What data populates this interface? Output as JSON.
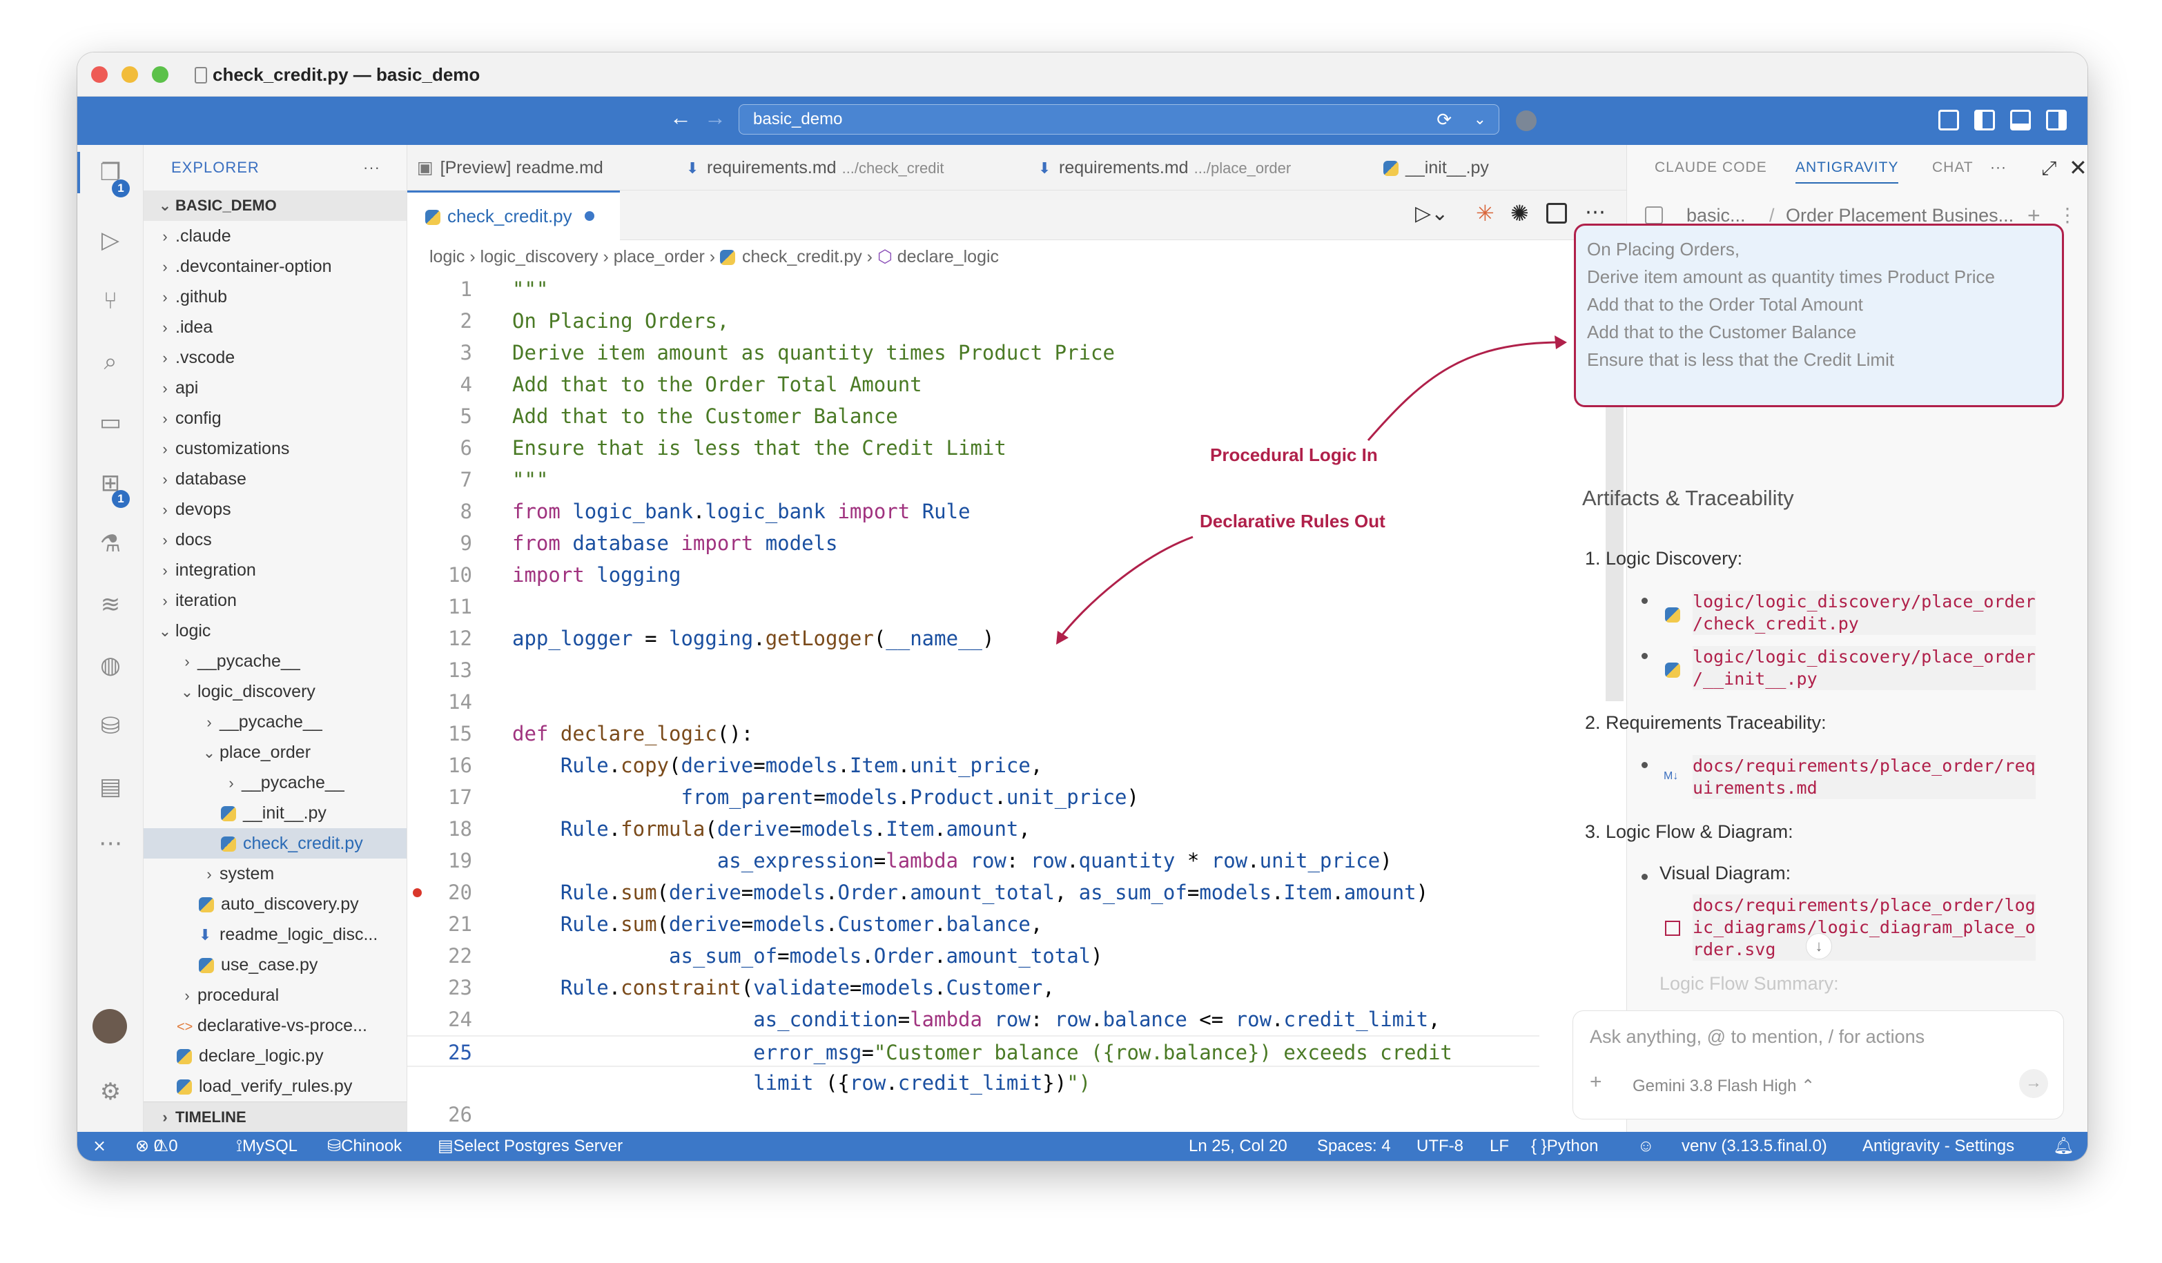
{
  "window": {
    "title": "check_credit.py — basic_demo"
  },
  "command_center": {
    "text": "basic_demo"
  },
  "activity": {
    "explorer_badge": "1",
    "extensions_badge": "1"
  },
  "explorer": {
    "header": "EXPLORER",
    "more": "···",
    "section": "BASIC_DEMO",
    "timeline": "TIMELINE",
    "items": [
      {
        "label": ".claude",
        "chev": "›"
      },
      {
        "label": ".devcontainer-option",
        "chev": "›"
      },
      {
        "label": ".github",
        "chev": "›"
      },
      {
        "label": ".idea",
        "chev": "›"
      },
      {
        "label": ".vscode",
        "chev": "›"
      },
      {
        "label": "api",
        "chev": "›"
      },
      {
        "label": "config",
        "chev": "›"
      },
      {
        "label": "customizations",
        "chev": "›"
      },
      {
        "label": "database",
        "chev": "›"
      },
      {
        "label": "devops",
        "chev": "›"
      },
      {
        "label": "docs",
        "chev": "›"
      },
      {
        "label": "integration",
        "chev": "›"
      },
      {
        "label": "iteration",
        "chev": "›"
      },
      {
        "label": "logic",
        "chev": "⌄"
      },
      {
        "label": "__pycache__",
        "chev": "›"
      },
      {
        "label": "logic_discovery",
        "chev": "⌄"
      },
      {
        "label": "__pycache__",
        "chev": "›"
      },
      {
        "label": "place_order",
        "chev": "⌄"
      },
      {
        "label": "__pycache__",
        "chev": "›"
      },
      {
        "label": "__init__.py"
      },
      {
        "label": "check_credit.py"
      },
      {
        "label": "system",
        "chev": "›"
      },
      {
        "label": "auto_discovery.py"
      },
      {
        "label": "readme_logic_disc..."
      },
      {
        "label": "use_case.py"
      },
      {
        "label": "procedural",
        "chev": "›"
      },
      {
        "label": "declarative-vs-proce..."
      },
      {
        "label": "declare_logic.py"
      },
      {
        "label": "load_verify_rules.py"
      }
    ]
  },
  "tabs": [
    {
      "label": "[Preview] readme.md",
      "hint": ""
    },
    {
      "label": "requirements.md",
      "hint": ".../check_credit"
    },
    {
      "label": "requirements.md",
      "hint": ".../place_order"
    },
    {
      "label": "__init__.py",
      "hint": ""
    }
  ],
  "active_tab": {
    "label": "check_credit.py"
  },
  "breadcrumb": [
    "logic",
    "logic_discovery",
    "place_order",
    "check_credit.py",
    "declare_logic"
  ],
  "code_lines": [
    {
      "n": "1",
      "t": "\"\"\""
    },
    {
      "n": "2",
      "t": "On Placing Orders,"
    },
    {
      "n": "3",
      "t": "Derive item amount as quantity times Product Price"
    },
    {
      "n": "4",
      "t": "Add that to the Order Total Amount"
    },
    {
      "n": "5",
      "t": "Add that to the Customer Balance"
    },
    {
      "n": "6",
      "t": "Ensure that is less that the Credit Limit"
    },
    {
      "n": "7",
      "t": "\"\"\""
    },
    {
      "n": "8",
      "t": "from logic_bank.logic_bank import Rule"
    },
    {
      "n": "9",
      "t": "from database import models"
    },
    {
      "n": "10",
      "t": "import logging"
    },
    {
      "n": "11",
      "t": ""
    },
    {
      "n": "12",
      "t": "app_logger = logging.getLogger(__name__)"
    },
    {
      "n": "13",
      "t": ""
    },
    {
      "n": "14",
      "t": ""
    },
    {
      "n": "15",
      "t": "def declare_logic():"
    },
    {
      "n": "16",
      "t": "    Rule.copy(derive=models.Item.unit_price,"
    },
    {
      "n": "17",
      "t": "              from_parent=models.Product.unit_price)"
    },
    {
      "n": "18",
      "t": "    Rule.formula(derive=models.Item.amount,"
    },
    {
      "n": "19",
      "t": "                 as_expression=lambda row: row.quantity * row.unit_price)"
    },
    {
      "n": "20",
      "t": "    Rule.sum(derive=models.Order.amount_total, as_sum_of=models.Item.amount)"
    },
    {
      "n": "21",
      "t": "    Rule.sum(derive=models.Customer.balance,"
    },
    {
      "n": "22",
      "t": "             as_sum_of=models.Order.amount_total)"
    },
    {
      "n": "23",
      "t": "    Rule.constraint(validate=models.Customer,"
    },
    {
      "n": "24",
      "t": "                    as_condition=lambda row: row.balance <= row.credit_limit,"
    },
    {
      "n": "25",
      "t": "                    error_msg=\"Customer balance ({row.balance}) exceeds credit"
    },
    {
      "n": "",
      "t": "                    limit ({row.credit_limit})\")"
    },
    {
      "n": "26",
      "t": ""
    }
  ],
  "annotations": {
    "procedural": "Procedural Logic In",
    "declarative": "Declarative Rules Out"
  },
  "panel": {
    "tabs": [
      "CLAUDE CODE",
      "ANTIGRAVITY",
      "CHAT"
    ],
    "more": "···",
    "crumb_root": "basic...",
    "crumb_title": "Order Placement Busines...",
    "prompt_lines": [
      "On Placing Orders,",
      "Derive item amount as quantity times Product Price",
      "Add that to the Order Total Amount",
      "Add that to the Customer Balance",
      "Ensure that is less that the Credit Limit"
    ],
    "heading": "Artifacts & Traceability",
    "s1": "1. Logic Discovery:",
    "s1a": "logic/logic_discovery/place_order\n/check_credit.py",
    "s1b": "logic/logic_discovery/place_order\n/__init__.py",
    "s2": "2. Requirements Traceability:",
    "s2a": "docs/requirements/place_order/req\nuirements.md",
    "s3": "3. Logic Flow & Diagram:",
    "s3a": "Visual Diagram:",
    "s3b": "docs/requirements/place_order/log\nic_diagrams/logic_diagram_place_o\nrder.svg",
    "s3c": "Logic Flow Summary:",
    "chat_placeholder": "Ask anything, @ to mention, / for actions",
    "model": "Gemini 3.8 Flash High"
  },
  "status": {
    "errors": "0",
    "warnings": "0",
    "db": "MySQL",
    "db2": "Chinook",
    "pg": "Select Postgres Server",
    "pos": "Ln 25, Col 20",
    "spaces": "Spaces: 4",
    "enc": "UTF-8",
    "eol": "LF",
    "lang": "Python",
    "venv": "venv (3.13.5.final.0)",
    "settings": "Antigravity - Settings"
  }
}
